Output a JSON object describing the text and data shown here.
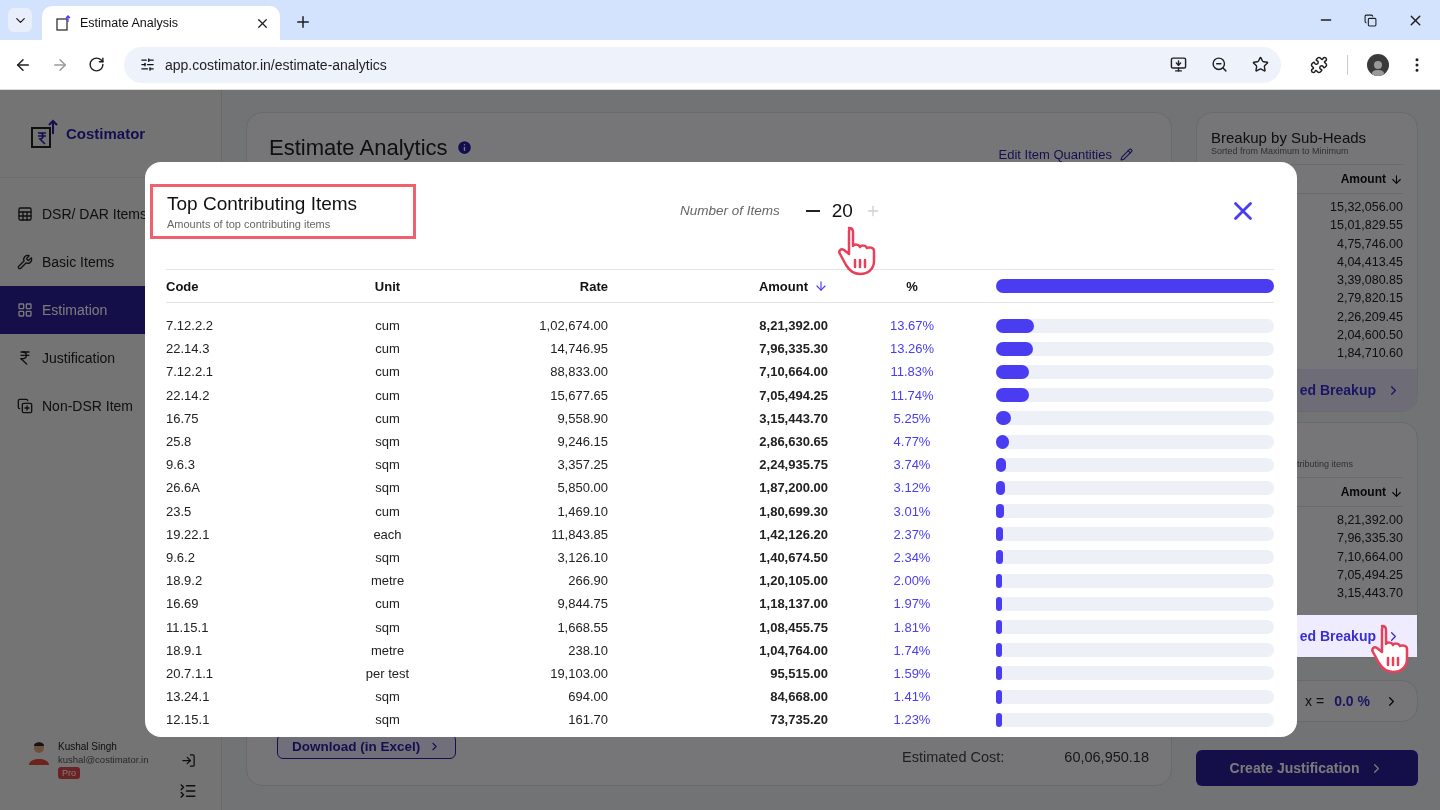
{
  "browser": {
    "tab_title": "Estimate Analysis",
    "url": "app.costimator.in/estimate-analytics"
  },
  "sidebar": {
    "brand": "Costimator",
    "items": [
      {
        "label": "DSR/ DAR Items",
        "selected": false
      },
      {
        "label": "Basic Items",
        "selected": false
      },
      {
        "label": "Estimation",
        "selected": true
      },
      {
        "label": "Justification",
        "selected": false
      },
      {
        "label": "Non-DSR Item",
        "selected": false
      }
    ],
    "user": {
      "name": "Kushal Singh",
      "email": "kushal@costimator.in",
      "badge": "Pro"
    }
  },
  "main": {
    "title": "Estimate Analytics",
    "edit_link": "Edit Item Quantities",
    "download_button": "Download (in Excel)",
    "estimated_cost_label": "Estimated Cost:",
    "estimated_cost_value": "60,06,950.18"
  },
  "right_panel": {
    "subheads": {
      "title": "Breakup by Sub-Heads",
      "subtitle": "Sorted from Maximum to Minimum",
      "column": "Amount",
      "values": [
        "15,32,056.00",
        "15,01,829.55",
        "4,75,746.00",
        "4,04,413.45",
        "3,39,080.85",
        "2,79,820.15",
        "2,26,209.45",
        "2,04,600.50",
        "1,84,710.60"
      ],
      "button": "ed Breakup"
    },
    "top_items": {
      "subtitle": "tributing items",
      "column": "Amount",
      "values": [
        "8,21,392.00",
        "7,96,335.30",
        "7,10,664.00",
        "7,05,494.25",
        "3,15,443.70"
      ],
      "button": "ed Breakup"
    },
    "index": {
      "label": "x =",
      "value": "0.0 %"
    },
    "create_button": "Create Justification"
  },
  "modal": {
    "title": "Top Contributing Items",
    "subtitle": "Amounts of top contributing items",
    "count_label": "Number of Items",
    "count": "20",
    "increment_disabled": true,
    "columns": [
      {
        "label": "Code",
        "sorted": false
      },
      {
        "label": "Unit",
        "sorted": false
      },
      {
        "label": "Rate",
        "sorted": false
      },
      {
        "label": "Amount",
        "sorted": true
      },
      {
        "label": "%",
        "sorted": false
      }
    ],
    "rows": [
      {
        "code": "7.12.2.2",
        "unit": "cum",
        "rate": "1,02,674.00",
        "amount": "8,21,392.00",
        "percent": "13.67%",
        "level": 0.1367
      },
      {
        "code": "22.14.3",
        "unit": "cum",
        "rate": "14,746.95",
        "amount": "7,96,335.30",
        "percent": "13.26%",
        "level": 0.1326
      },
      {
        "code": "7.12.2.1",
        "unit": "cum",
        "rate": "88,833.00",
        "amount": "7,10,664.00",
        "percent": "11.83%",
        "level": 0.1183
      },
      {
        "code": "22.14.2",
        "unit": "cum",
        "rate": "15,677.65",
        "amount": "7,05,494.25",
        "percent": "11.74%",
        "level": 0.1174
      },
      {
        "code": "16.75",
        "unit": "cum",
        "rate": "9,558.90",
        "amount": "3,15,443.70",
        "percent": "5.25%",
        "level": 0.0525
      },
      {
        "code": "25.8",
        "unit": "sqm",
        "rate": "9,246.15",
        "amount": "2,86,630.65",
        "percent": "4.77%",
        "level": 0.0477
      },
      {
        "code": "9.6.3",
        "unit": "sqm",
        "rate": "3,357.25",
        "amount": "2,24,935.75",
        "percent": "3.74%",
        "level": 0.0374
      },
      {
        "code": "26.6A",
        "unit": "sqm",
        "rate": "5,850.00",
        "amount": "1,87,200.00",
        "percent": "3.12%",
        "level": 0.0312
      },
      {
        "code": "23.5",
        "unit": "cum",
        "rate": "1,469.10",
        "amount": "1,80,699.30",
        "percent": "3.01%",
        "level": 0.0301
      },
      {
        "code": "19.22.1",
        "unit": "each",
        "rate": "11,843.85",
        "amount": "1,42,126.20",
        "percent": "2.37%",
        "level": 0.0237
      },
      {
        "code": "9.6.2",
        "unit": "sqm",
        "rate": "3,126.10",
        "amount": "1,40,674.50",
        "percent": "2.34%",
        "level": 0.0234
      },
      {
        "code": "18.9.2",
        "unit": "metre",
        "rate": "266.90",
        "amount": "1,20,105.00",
        "percent": "2.00%",
        "level": 0.02
      },
      {
        "code": "16.69",
        "unit": "cum",
        "rate": "9,844.75",
        "amount": "1,18,137.00",
        "percent": "1.97%",
        "level": 0.0197
      },
      {
        "code": "11.15.1",
        "unit": "sqm",
        "rate": "1,668.55",
        "amount": "1,08,455.75",
        "percent": "1.81%",
        "level": 0.0181
      },
      {
        "code": "18.9.1",
        "unit": "metre",
        "rate": "238.10",
        "amount": "1,04,764.00",
        "percent": "1.74%",
        "level": 0.0174
      },
      {
        "code": "20.7.1.1",
        "unit": "per test",
        "rate": "19,103.00",
        "amount": "95,515.00",
        "percent": "1.59%",
        "level": 0.0159
      },
      {
        "code": "13.24.1",
        "unit": "sqm",
        "rate": "694.00",
        "amount": "84,668.00",
        "percent": "1.41%",
        "level": 0.0141
      },
      {
        "code": "12.15.1",
        "unit": "sqm",
        "rate": "161.70",
        "amount": "73,735.20",
        "percent": "1.23%",
        "level": 0.0123
      }
    ]
  }
}
